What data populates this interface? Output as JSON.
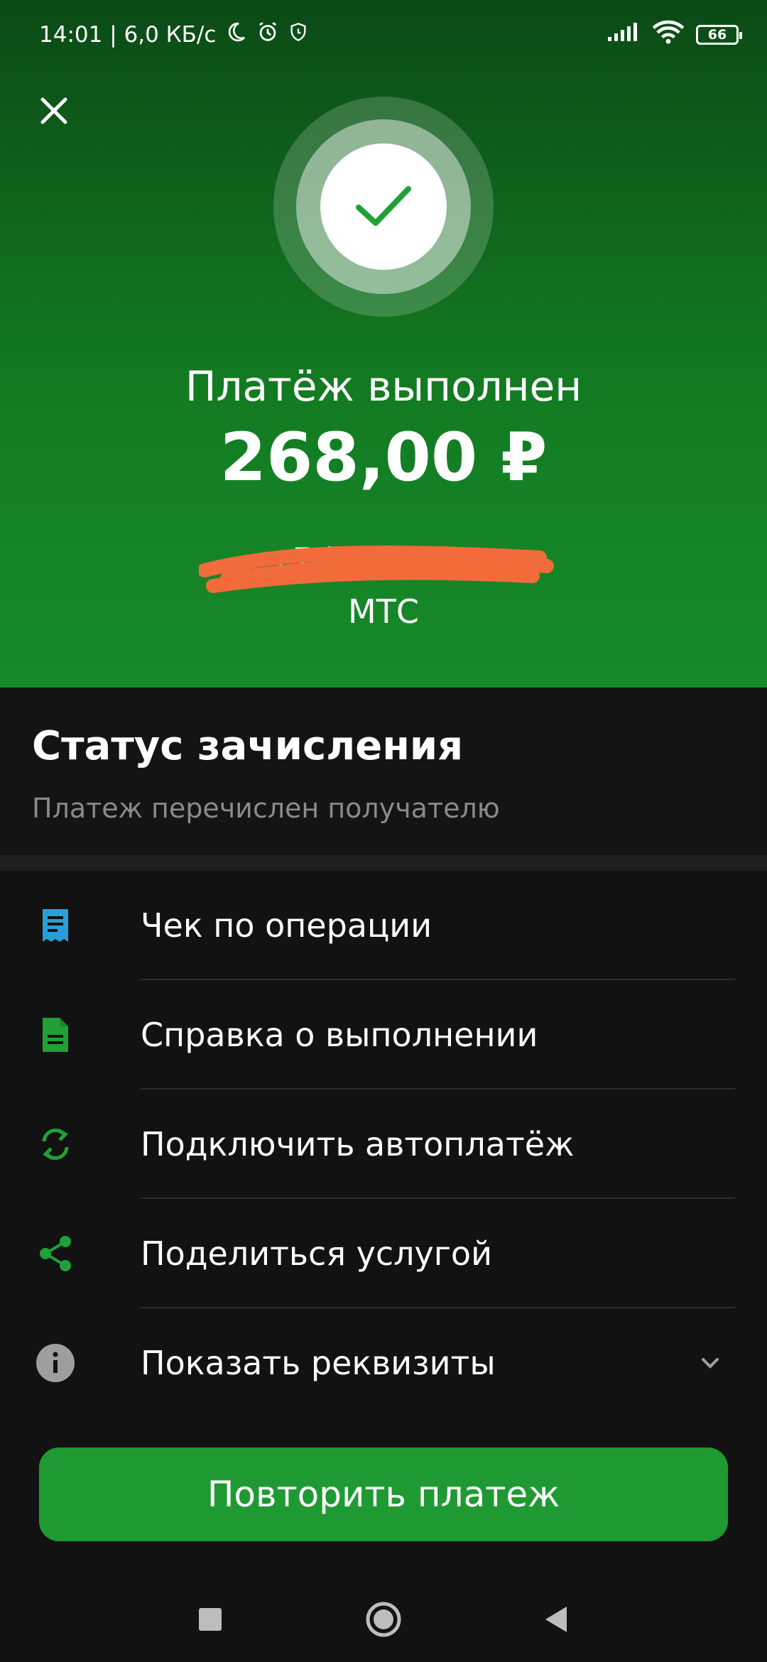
{
  "status_bar": {
    "time_speed": "14:01 | 6,0 КБ/с",
    "battery": "66"
  },
  "header": {
    "title": "Платёж выполнен",
    "amount": "268,00 ₽",
    "phone_masked": "+7 (9··) ·7·-·7-··",
    "provider": "МТС"
  },
  "status": {
    "title": "Статус зачисления",
    "description": "Платеж перечислен получателю"
  },
  "menu": [
    {
      "label": "Чек по операции",
      "icon": "receipt-icon",
      "color": "#2a9fd6"
    },
    {
      "label": "Справка о выполнении",
      "icon": "document-icon",
      "color": "#21a038"
    },
    {
      "label": "Подключить автоплатёж",
      "icon": "autopay-sync-icon",
      "color": "#21a038"
    },
    {
      "label": "Поделиться услугой",
      "icon": "share-icon",
      "color": "#21a038"
    },
    {
      "label": "Показать реквизиты",
      "icon": "info-icon",
      "color": "#9e9e9e"
    }
  ],
  "repeat_button": "Повторить платеж",
  "colors": {
    "accent": "#21a038",
    "button": "#1f9a32",
    "redaction": "#f26b3a"
  }
}
